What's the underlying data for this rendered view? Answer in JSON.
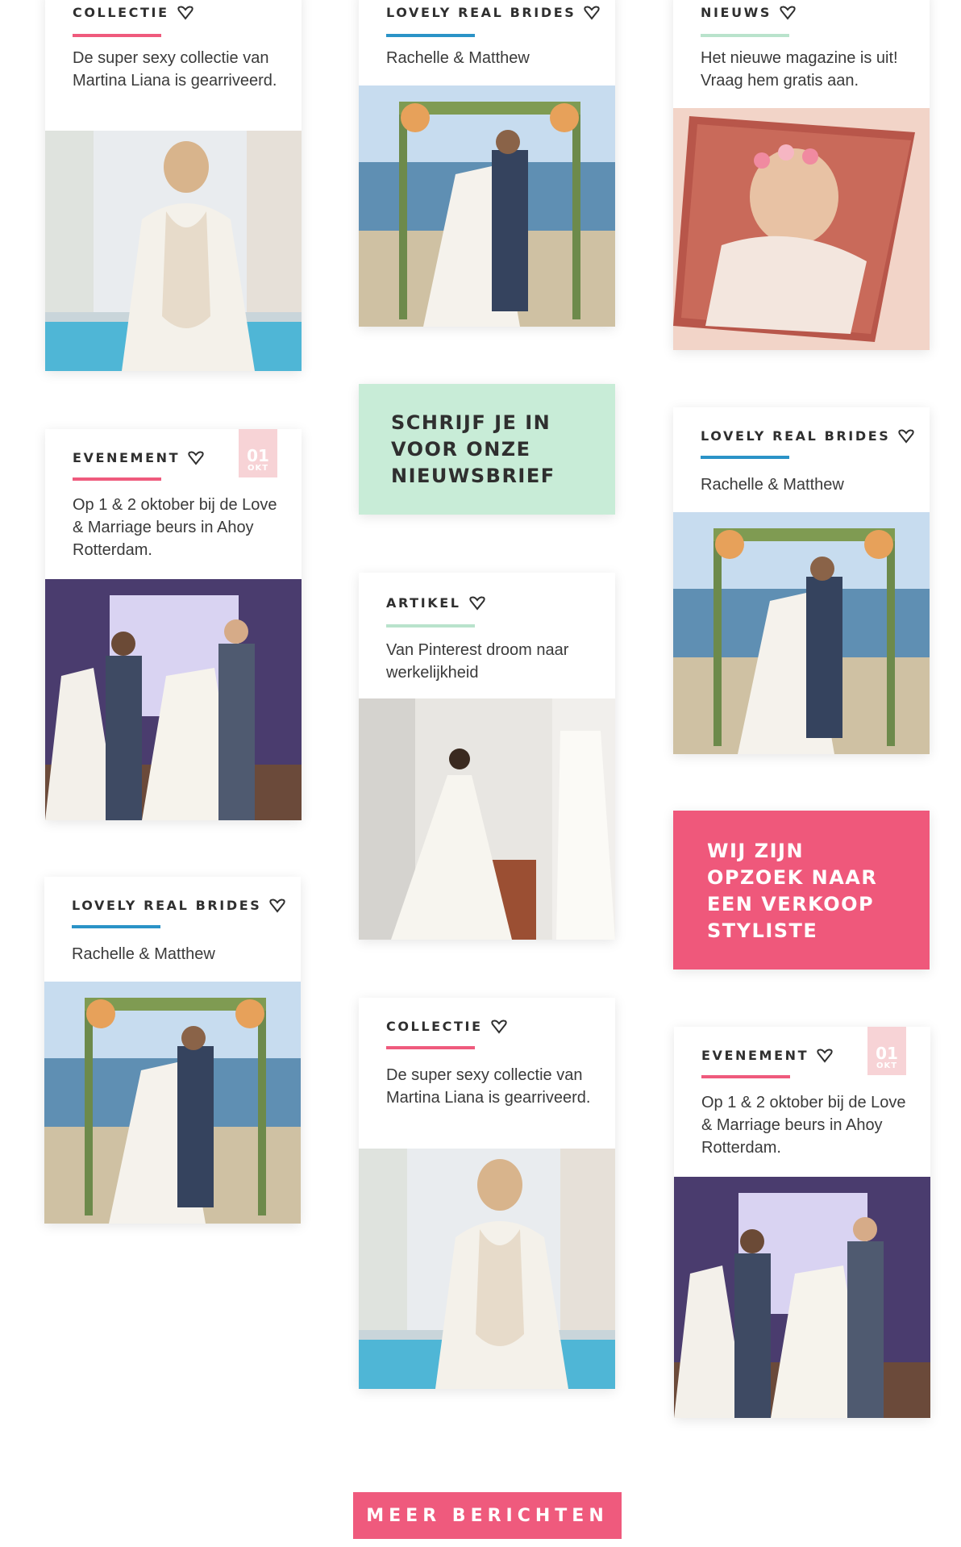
{
  "colors": {
    "pink": "#ef5a7d",
    "blue": "#2b93c7",
    "mint": "#b9e3cc",
    "mint_bg": "#c8ecd7",
    "pink_bg": "#ef587b",
    "badge": "#f7d3d6"
  },
  "cards": [
    {
      "id": "c1",
      "tag": "COLLECTIE",
      "rule_color": "pink",
      "text": "De super sexy collectie van Martina Liana is gearriveerd.",
      "image": "bride-lace-back-pool-photo"
    },
    {
      "id": "c2",
      "tag": "LOVELY REAL BRIDES",
      "rule_color": "blue",
      "text": "Rachelle & Matthew",
      "image": "beach-wedding-kiss-photo"
    },
    {
      "id": "c3",
      "tag": "NIEUWS",
      "rule_color": "mint",
      "text": "Het nieuwe magazine is uit! Vraag hem gratis aan.",
      "image": "magazine-cover-photo"
    },
    {
      "id": "c4",
      "tag": "EVENEMENT",
      "rule_color": "pink",
      "text": "Op 1 & 2 oktober bij de Love & Marriage beurs in Ahoy Rotterdam.",
      "image": "bridal-show-stage-photo",
      "date": {
        "day": "01",
        "month": "OKT"
      }
    },
    {
      "id": "c5",
      "tag": "LOVELY REAL BRIDES",
      "rule_color": "blue",
      "text": "Rachelle & Matthew",
      "image": "beach-wedding-kiss-photo"
    },
    {
      "id": "c6",
      "tag": "ARTIKEL",
      "rule_color": "mint",
      "text": "Van Pinterest droom naar werkelijkheid",
      "image": "bridal-boutique-gown-photo"
    },
    {
      "id": "c7",
      "tag": "LOVELY REAL BRIDES",
      "rule_color": "blue",
      "text": "Rachelle & Matthew",
      "image": "beach-wedding-kiss-photo"
    },
    {
      "id": "c8",
      "tag": "COLLECTIE",
      "rule_color": "pink",
      "text": "De super sexy collectie van Martina Liana is gearriveerd.",
      "image": "bride-lace-back-pool-photo"
    },
    {
      "id": "c9",
      "tag": "EVENEMENT",
      "rule_color": "pink",
      "text": "Op 1 & 2 oktober bij de Love & Marriage beurs in Ahoy Rotterdam.",
      "image": "bridal-show-stage-photo",
      "date": {
        "day": "01",
        "month": "OKT"
      }
    }
  ],
  "newsletter": {
    "text": "SCHRIJF JE IN VOOR ONZE NIEUWSBRIEF"
  },
  "vacancy": {
    "text": "WIJ ZIJN OPZOEK NAAR EEN VERKOOP STYLISTE"
  },
  "more_button": {
    "label": "MEER BERICHTEN"
  }
}
